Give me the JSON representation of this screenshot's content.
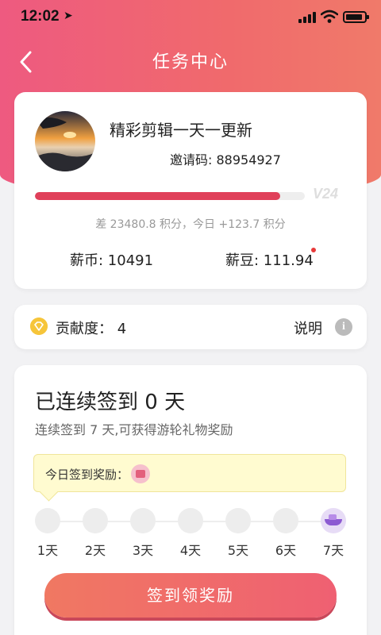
{
  "status_bar": {
    "time": "12:02",
    "location_icon": "location-arrow-icon"
  },
  "nav": {
    "title": "任务中心",
    "back_icon": "chevron-left-icon"
  },
  "profile": {
    "name": "精彩剪辑一天一更新",
    "invite": "邀请码: 88954927",
    "level_progress": 0.91,
    "vip_label": "V24",
    "progress_text": "差 23480.8 积分，今日 +123.7 积分",
    "coins": "薪币: 10491",
    "beans": "薪豆: 111.94"
  },
  "contribution": {
    "label": "贡献度：  4",
    "explain_label": "说明",
    "info_icon": "i"
  },
  "checkin": {
    "title": "已连续签到 0 天",
    "subtitle": "连续签到 7 天,可获得游轮礼物奖励",
    "reward_label": "今日签到奖励：",
    "days": [
      "1天",
      "2天",
      "3天",
      "4天",
      "5天",
      "6天",
      "7天"
    ],
    "button_label": "签到领奖励"
  },
  "colors": {
    "accent": "#e0405a",
    "header_start": "#ee5a80",
    "header_end": "#f07a6a"
  }
}
